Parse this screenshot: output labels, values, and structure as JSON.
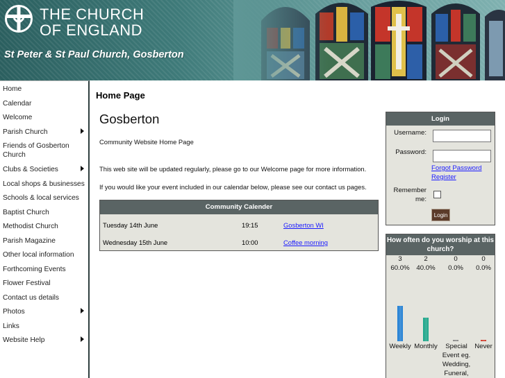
{
  "header": {
    "org_line1": "THE CHURCH",
    "org_line2": "OF ENGLAND",
    "site_name": "St Peter & St Paul Church, Gosberton"
  },
  "sidebar": {
    "items": [
      {
        "label": "Home",
        "submenu": false
      },
      {
        "label": "Calendar",
        "submenu": false
      },
      {
        "label": "Welcome",
        "submenu": false
      },
      {
        "label": "Parish Church",
        "submenu": true
      },
      {
        "label": "Friends of Gosberton Church",
        "submenu": false
      },
      {
        "label": "Clubs & Societies",
        "submenu": true
      },
      {
        "label": "Local shops & businesses",
        "submenu": false
      },
      {
        "label": "Schools & local services",
        "submenu": false
      },
      {
        "label": "Baptist Church",
        "submenu": false
      },
      {
        "label": "Methodist Church",
        "submenu": false
      },
      {
        "label": "Parish Magazine",
        "submenu": false
      },
      {
        "label": "Other local information",
        "submenu": false
      },
      {
        "label": "Forthcoming Events",
        "submenu": false
      },
      {
        "label": "Flower Festival",
        "submenu": false
      },
      {
        "label": "Contact us details",
        "submenu": false
      },
      {
        "label": "Photos",
        "submenu": true
      },
      {
        "label": "Links",
        "submenu": false
      },
      {
        "label": "Website Help",
        "submenu": true
      }
    ]
  },
  "main": {
    "page_title": "Home Page",
    "heading": "Gosberton",
    "subtitle": "Community Website Home Page",
    "para1": "This web site will be updated regularly, please go to our Welcome page for more information.",
    "para2": "If you would like your event included in our calendar below, please see our contact us pages."
  },
  "calendar": {
    "title": "Community Calender",
    "rows": [
      {
        "date": "Tuesday 14th June",
        "time": "19:15",
        "event": "Gosberton WI"
      },
      {
        "date": "Wednesday 15th June",
        "time": "10:00",
        "event": "Coffee morning"
      }
    ]
  },
  "login": {
    "title": "Login",
    "username_label": "Username:",
    "password_label": "Password:",
    "forgot_link": "Forgot Password",
    "register_link": "Register",
    "remember_label_1": "Remember",
    "remember_label_2": "me:",
    "button_label": "Login"
  },
  "poll": {
    "question": "How often do you worship at this church?",
    "options": [
      {
        "count": "3",
        "percent": "60.0%",
        "share": 0.6,
        "label": "Weekly",
        "color": "#1f7fd6"
      },
      {
        "count": "2",
        "percent": "40.0%",
        "share": 0.4,
        "label": "Monthly",
        "color": "#1aa68a"
      },
      {
        "count": "0",
        "percent": "0.0%",
        "share": 0,
        "label": "Special Event eg. Wedding, Funeral,",
        "color": "#8a8a8a"
      },
      {
        "count": "0",
        "percent": "0.0%",
        "share": 0,
        "label": "Never",
        "color": "#d23a2a"
      }
    ]
  }
}
